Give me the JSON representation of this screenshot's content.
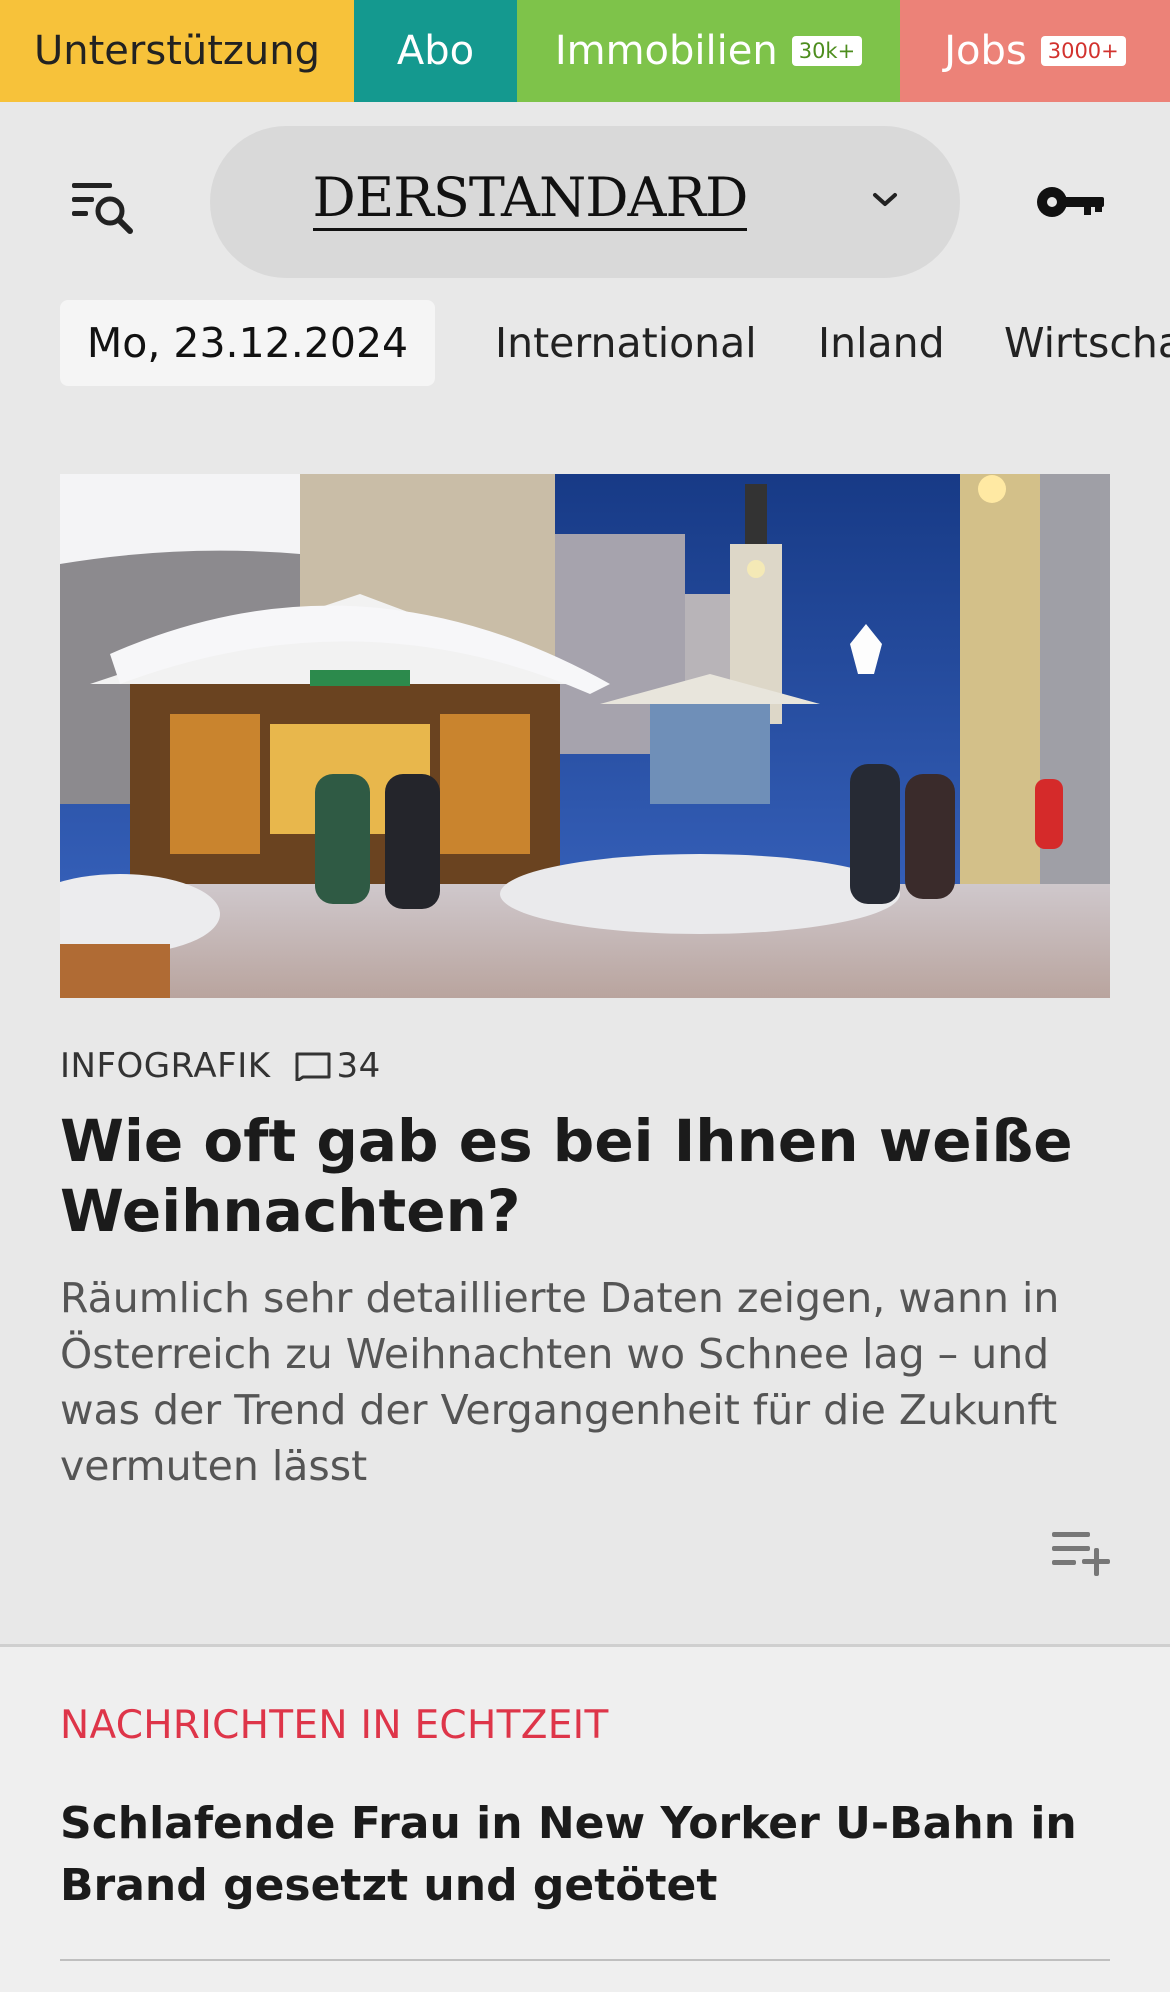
{
  "topbar": {
    "support_label": "Unterstützung",
    "abo_label": "Abo",
    "immo_label": "Immobilien",
    "immo_badge": "30k+",
    "jobs_label": "Jobs",
    "jobs_badge": "3000+"
  },
  "header": {
    "logo": "DERSTANDARD",
    "icons": [
      "menu-search-icon",
      "chevron-down-icon",
      "key-icon"
    ]
  },
  "nav": {
    "date": "Mo, 23.12.2024",
    "items": [
      "International",
      "Inland",
      "Wirtscha"
    ]
  },
  "article": {
    "kicker": "INFOGRAFIK",
    "comment_count": "34",
    "headline": "Wie oft gab es bei Ihnen weiße Weihnachten?",
    "teaser": "Räumlich sehr detaillierte Daten zeigen, wann in Österreich zu Weihnachten wo Schnee lag – und was der Trend der Vergangenheit für die Zukunft vermuten lässt"
  },
  "live": {
    "section_title": "NACHRICHTEN IN ECHTZEIT",
    "headline": "Schlafende Frau in New Yorker U-Bahn in Brand gesetzt und getötet"
  },
  "colors": {
    "support": "#f7c23a",
    "abo": "#14998f",
    "immo": "#7ec34a",
    "jobs": "#ec8278",
    "live_red": "#de3549"
  }
}
